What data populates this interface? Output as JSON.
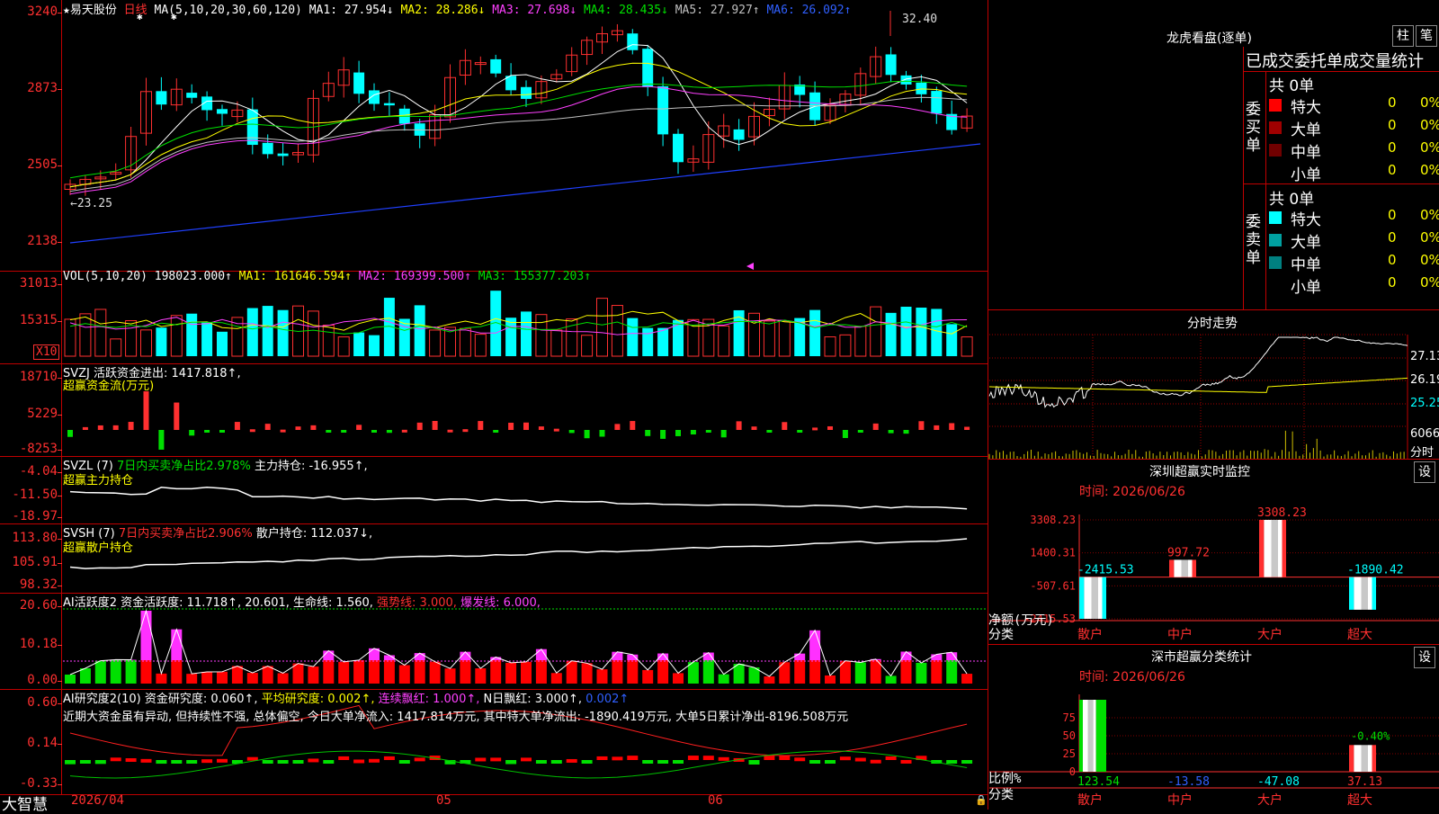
{
  "main": {
    "star": "★",
    "stock_name": "易天股份",
    "period": "日线",
    "ma_label": "MA(5,10,20,30,60,120)",
    "ma": [
      {
        "text": "MA1: 27.954↓",
        "color": "#ffffff"
      },
      {
        "text": "MA2: 28.286↓",
        "color": "#ffff00"
      },
      {
        "text": "MA3: 27.698↓",
        "color": "#ff40ff"
      },
      {
        "text": "MA4: 28.435↓",
        "color": "#00e000"
      },
      {
        "text": "MA5: 27.927↑",
        "color": "#c0c0c0"
      },
      {
        "text": "MA6: 26.092↑",
        "color": "#3060ff"
      }
    ],
    "y_ticks": [
      "3240",
      "2873",
      "2505",
      "2138"
    ],
    "high_label": "32.40",
    "low_label": "←23.25"
  },
  "vol": {
    "label": "VOL(5,10,20)",
    "value": "198023.000↑",
    "ma": [
      {
        "text": "MA1: 161646.594↑",
        "color": "#ffff00"
      },
      {
        "text": "MA2: 169399.500↑",
        "color": "#ff40ff"
      },
      {
        "text": "MA3: 155377.203↑",
        "color": "#00e000"
      }
    ],
    "y_ticks": [
      "31013",
      "15315"
    ],
    "unit": "X10"
  },
  "svzj": {
    "label": "SVZJ  活跃资金进出: 1417.818↑,",
    "sub": "超赢资金流(万元)",
    "y_ticks": [
      "18710",
      "5229",
      "-8253"
    ]
  },
  "svzl": {
    "label": "SVZL (7)",
    "mid": "7日内买卖净占比2.978%",
    "tail": "主力持仓: -16.955↑,",
    "sub": "超赢主力持仓",
    "y_ticks": [
      "-4.04",
      "-11.50",
      "-18.97"
    ]
  },
  "svsh": {
    "label": "SVSH (7)",
    "mid": "7日内买卖净占比2.906%",
    "tail": "散户持仓: 112.037↓,",
    "sub": "超赢散户持仓",
    "y_ticks": [
      "113.80",
      "105.91",
      "98.32"
    ]
  },
  "ai1": {
    "label": "AI活跃度2 资金活跃度: 11.718↑, 20.601, 生命线: 1.560,",
    "strong": "强势线: 3.000,",
    "burst": "爆发线: 6.000,",
    "y_ticks": [
      "20.60",
      "10.18",
      "0.00"
    ]
  },
  "ai2": {
    "label": "AI研究度2(10) 资金研究度: 0.060↑,",
    "avg": "平均研究度: 0.002↑,",
    "red1": "连续飘红: 1.000↑,",
    "red2": "N日飘红: 3.000↑,",
    "last": "0.002↑",
    "note": "近期大资金虽有异动, 但持续性不强, 总体偏空, 今日大单净流入: 1417.814万元, 其中特大单净流出: -1890.419万元, 大单5日累计净出-8196.508万元",
    "y_ticks": [
      "0.60",
      "0.14",
      "-0.33"
    ]
  },
  "bottom": {
    "logo": "大智慧",
    "date_start": "2026/04",
    "m05": "05",
    "m06": "06"
  },
  "right": {
    "lhb_title": "龙虎看盘(逐单)",
    "btn_zhu": "柱",
    "btn_bi": "笔",
    "table_title": "已成交委托单成交量统计",
    "buy_label": "委买单",
    "sell_label": "委卖单",
    "buy_total": "共 0单",
    "sell_total": "共 0单",
    "buy_rows": [
      {
        "name": "特大",
        "count": "0",
        "pct": "0%",
        "color": "#ff0000"
      },
      {
        "name": "大单",
        "count": "0",
        "pct": "0%",
        "color": "#a00000"
      },
      {
        "name": "中单",
        "count": "0",
        "pct": "0%",
        "color": "#700000"
      },
      {
        "name": "小单",
        "count": "0",
        "pct": "0%",
        "color": ""
      }
    ],
    "sell_rows": [
      {
        "name": "特大",
        "count": "0",
        "pct": "0%",
        "color": "#00ffff"
      },
      {
        "name": "大单",
        "count": "0",
        "pct": "0%",
        "color": "#00a0a0"
      },
      {
        "name": "中单",
        "count": "0",
        "pct": "0%",
        "color": "#008080"
      },
      {
        "name": "小单",
        "count": "0",
        "pct": "0%",
        "color": ""
      }
    ],
    "fenshi_title": "分时走势",
    "fenshi_ticks": [
      "27.13",
      "26.19",
      "25.25",
      "6066"
    ],
    "fenshi_unit": "分时",
    "monitor_title": "深圳超赢实时监控",
    "monitor_time": "时间: 2026/06/26",
    "monitor_btn": "设",
    "monitor_y": [
      "3308.23",
      "1400.31",
      "-507.61",
      "-2415.53"
    ],
    "monitor_ylabel": "净额(万元)",
    "monitor_xlabel": "分类",
    "class_title": "深市超赢分类统计",
    "class_time": "时间: 2026/06/26",
    "class_btn": "设",
    "class_y": [
      "75",
      "50",
      "25",
      "0"
    ],
    "class_ylabel": "比例%",
    "class_xlabel": "分类",
    "categories": [
      "散户",
      "中户",
      "大户",
      "超大"
    ]
  },
  "chart_data": [
    {
      "type": "bar",
      "title": "深圳超赢实时监控",
      "ylabel": "净额(万元)",
      "xlabel": "分类",
      "categories": [
        "散户",
        "中户",
        "大户",
        "超大"
      ],
      "values": [
        -2415.53,
        997.72,
        3308.23,
        -1890.42
      ],
      "value_labels": [
        "-2415.53",
        "997.72",
        "3308.23",
        "-1890.42"
      ],
      "ylim": [
        -2415.53,
        3308.23
      ]
    },
    {
      "type": "bar",
      "title": "深市超赢分类统计",
      "ylabel": "比例%",
      "xlabel": "分类",
      "categories": [
        "散户",
        "中户",
        "大户",
        "超大"
      ],
      "values": [
        123.54,
        -13.58,
        -47.08,
        37.13
      ],
      "value_labels": [
        "123.54",
        "-13.58",
        "-47.08",
        "37.13"
      ],
      "extra_label": "-0.40%",
      "ylim": [
        0,
        100
      ]
    }
  ]
}
